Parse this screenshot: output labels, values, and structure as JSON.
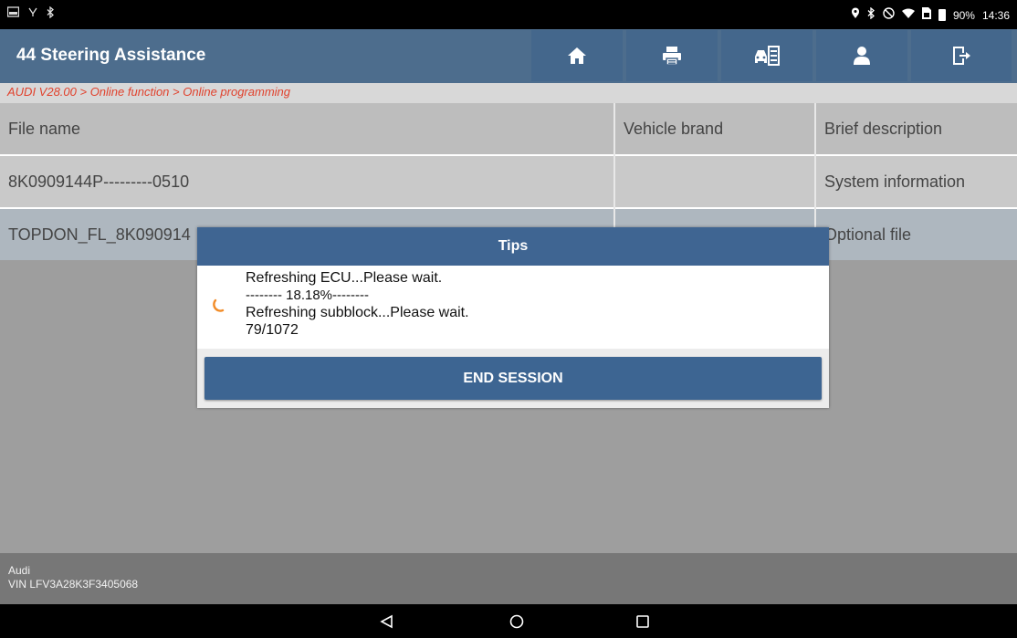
{
  "status_bar": {
    "time": "14:36",
    "battery": "90%",
    "left_icons": [
      "image-icon",
      "usb-icon",
      "bluetooth-icon"
    ],
    "right_icons": [
      "location-icon",
      "bluetooth-icon",
      "no-disturb-icon",
      "wifi-icon",
      "sim-icon",
      "battery-icon"
    ]
  },
  "header": {
    "title": "44 Steering Assistance",
    "buttons": [
      "home-icon",
      "print-icon",
      "car-report-icon",
      "user-icon",
      "exit-icon"
    ]
  },
  "breadcrumb": "AUDI V28.00 > Online function > Online programming",
  "table": {
    "columns": [
      "File name",
      "Vehicle brand",
      "Brief description"
    ],
    "rows": [
      [
        "8K0909144P---------0510",
        "",
        "System information"
      ],
      [
        "TOPDON_FL_8K090914",
        "",
        "Optional file"
      ]
    ]
  },
  "dialog": {
    "title": "Tips",
    "lines": [
      "Refreshing ECU...Please wait.",
      "-------- 18.18%--------",
      "Refreshing subblock...Please wait.",
      "79/1072"
    ],
    "button": "END SESSION"
  },
  "footer": {
    "make": "Audi",
    "vin": "VIN LFV3A28K3F3405068"
  },
  "colors": {
    "header": "#4d6d8d",
    "accent": "#3f6592",
    "breadcrumb_text": "#e0412c",
    "spinner": "#f28c28"
  }
}
